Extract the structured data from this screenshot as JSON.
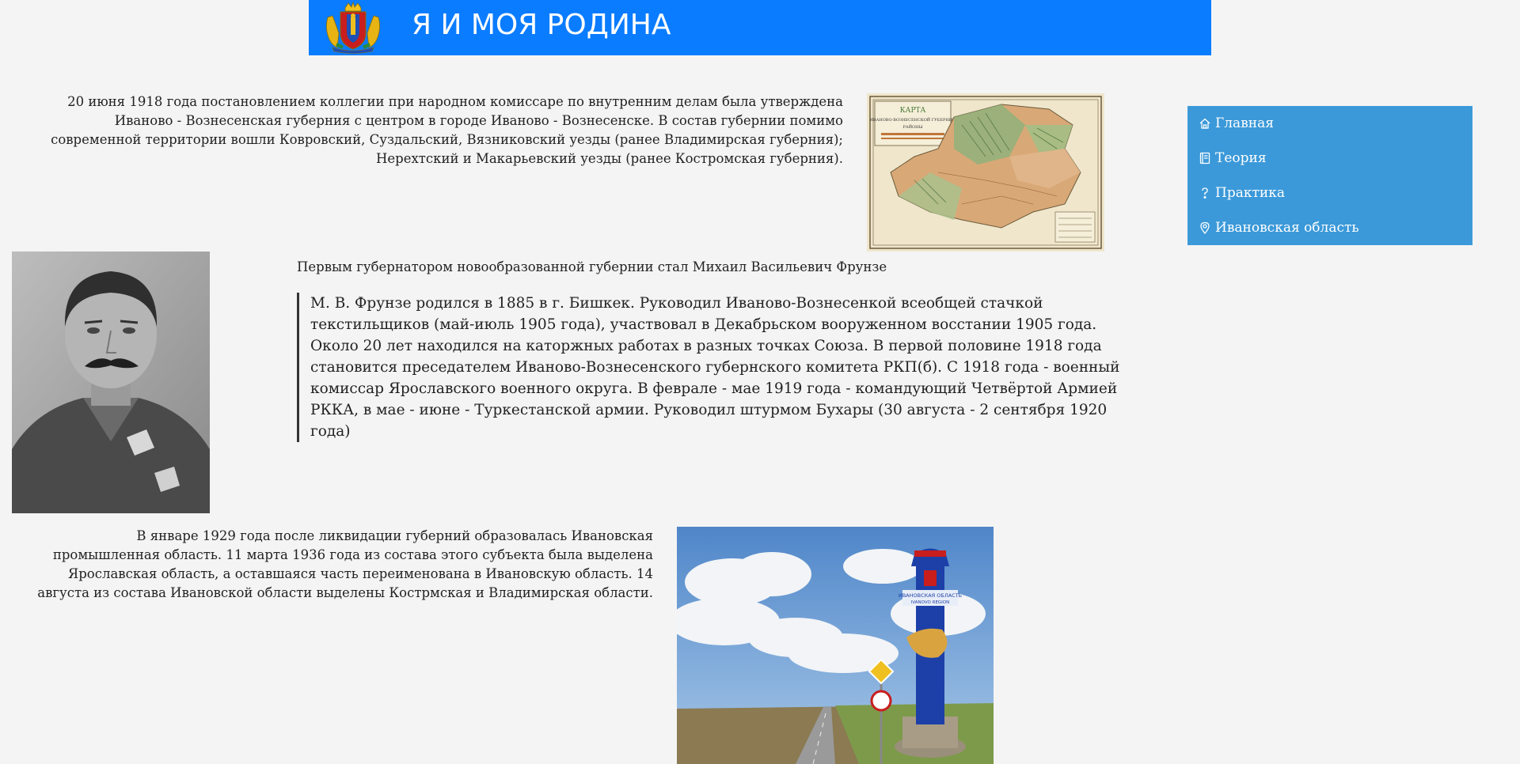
{
  "header": {
    "title": "Я И МОЯ РОДИНА",
    "logo_icon": "ivanovo-coat-of-arms-icon",
    "background": "#0a7cff"
  },
  "sidebar": {
    "background": "#3b99d9",
    "items": [
      {
        "label": "Главная",
        "icon": "home-icon"
      },
      {
        "label": "Теория",
        "icon": "book-icon"
      },
      {
        "label": "Практика",
        "icon": "question-icon"
      },
      {
        "label": "Ивановская область",
        "icon": "map-pin-icon"
      }
    ]
  },
  "main": {
    "paragraph1": "20 июня 1918 года постановлением коллегии при народном комиссаре по внутренним делам была утверждена Иваново - Вознесенская губерния с центром в городе Иваново - Вознесенске. В состав губернии помимо современной территории вошли Ковровский, Суздальский, Вязниковский уезды (ранее Владимирская губерния); Нерехтский и Макарьевский уезды (ранее Костромская губерния).",
    "map_image": {
      "title_line1": "КАРТА",
      "title_line2": "ИВАНОВО-ВОЗНЕСЕНСКОЙ ГУБЕРНИИ",
      "title_line3": "РАЙОНЫ"
    },
    "governor_line": "Первым губернатором новообразованной губернии стал Михаил Васильевич Фрунзе",
    "quote": "М. В. Фрунзе родился в 1885 в г. Бишкек. Руководил Иваново-Вознесенкой всеобщей стачкой текстильщиков (май-июль 1905 года), участвовал в Декабрьском вооруженном восстании 1905 года. Около 20 лет находился на каторжных работах в разных точках Союза. В первой половине 1918 года становится преседателем Иваново-Вознесенского губернского комитета РКП(б). С 1918 года - военный комиссар Ярославского военного округа. В феврале - мае 1919 года - командующий Четвёртой Армией РККА, в мае - июне - Туркестанской армии. Руководил штурмом Бухары (30 августа - 2 сентября 1920 года)",
    "paragraph3": "В январе 1929 года после ликвидации губерний образовалась Ивановская промышленная область. 11 марта 1936 года из состава этого субъекта была выделена Ярославская область, а оставшаяся часть переименована в Ивановскую область. 14 августа из состава Ивановской области выделены Кострмская и Владимирская области.",
    "sign_image": {
      "sign_text1": "ИВАНОВСКАЯ ОБЛАСТЬ",
      "sign_text2": "IVANOVO REGION"
    }
  }
}
